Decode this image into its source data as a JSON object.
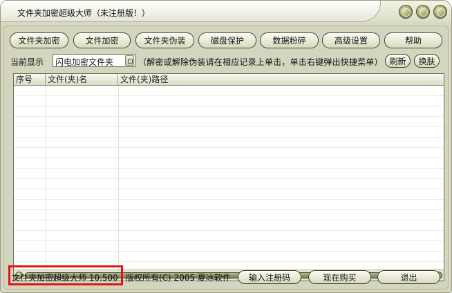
{
  "window": {
    "title": "文件夹加密超级大师（未注册版！）"
  },
  "toolbar": {
    "buttons": [
      "文件夹加密",
      "文件加密",
      "文件夹伪装",
      "磁盘保护",
      "数据粉碎",
      "高级设置",
      "帮助"
    ]
  },
  "display": {
    "label": "当前显示",
    "selected": "闪电加密文件夹",
    "hint": "（解密或解除伪装请在相应记录上单击，单击右键弹出快捷菜单）",
    "refresh_label": "刷新",
    "skin_label": "换肤"
  },
  "list": {
    "columns": [
      "序号",
      "文件(夹)名",
      "文件(夹)路径"
    ],
    "rows": []
  },
  "footer": {
    "version": "文件夹加密超级大师 10.500",
    "copyright": "版权所有(C)  2005 夏冰软件",
    "register_label": "输入注册码",
    "buy_label": "现在购买",
    "exit_label": "退出"
  },
  "colors": {
    "window_bg": "#d6d7c0",
    "button_border": "#3f4228",
    "highlight_box": "#e01414"
  },
  "icons": {
    "title_controls": [
      "minimize-icon",
      "maximize-icon",
      "close-icon"
    ]
  }
}
